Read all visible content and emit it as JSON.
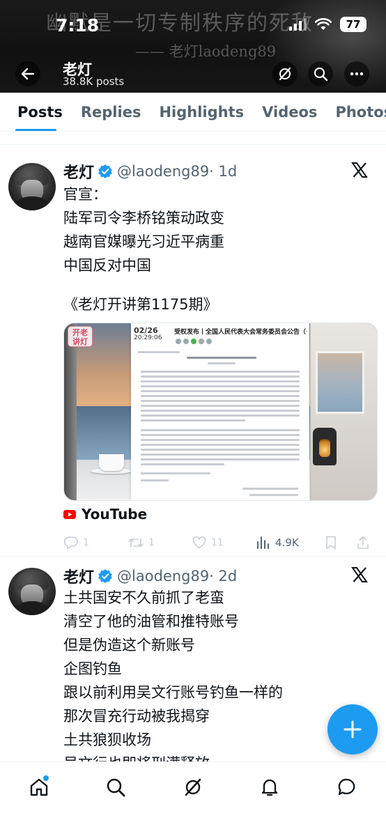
{
  "status_bar": {
    "time": "7:18",
    "battery": "77"
  },
  "banner": {
    "quote": "幽默是一切专制秩序的死敌",
    "signature": "—— 老灯laodeng89"
  },
  "header": {
    "name": "老灯",
    "post_count": "38.8K posts"
  },
  "tabs": [
    {
      "label": "Posts",
      "active": true
    },
    {
      "label": "Replies",
      "active": false
    },
    {
      "label": "Highlights",
      "active": false
    },
    {
      "label": "Videos",
      "active": false
    },
    {
      "label": "Photos",
      "active": false
    }
  ],
  "tweets": [
    {
      "name": "老灯",
      "handle": "@laodeng89",
      "time": "· 1d",
      "lines": [
        "官宣：",
        "陆军司令李桥铭策动政变",
        "越南官媒曝光习近平病重",
        "中国反对中国",
        "",
        "《老灯开讲第1175期》"
      ],
      "media": {
        "badge": "开老\n讲灯",
        "doc_title": "受权发布丨全国人民代表大会常务委员会公告（十四届）第十六号",
        "doc_date": "02/26",
        "doc_time": "20:29:06"
      },
      "link_source": "YouTube",
      "stats": {
        "replies": "1",
        "reposts": "1",
        "likes": "11",
        "views": "4.9K"
      }
    },
    {
      "name": "老灯",
      "handle": "@laodeng89",
      "time": "· 2d",
      "lines": [
        "土共国安不久前抓了老蛮",
        "清空了他的油管和推特账号",
        "但是伪造这个新账号",
        "企图钓鱼",
        "跟以前利用吴文行账号钓鱼一样的",
        "那次冒充行动被我揭穿",
        "土共狼狈收场",
        "吴文行也即将刑满释放"
      ]
    }
  ],
  "colors": {
    "accent": "#1d9bf0",
    "text": "#0f1419",
    "muted": "#536471"
  }
}
